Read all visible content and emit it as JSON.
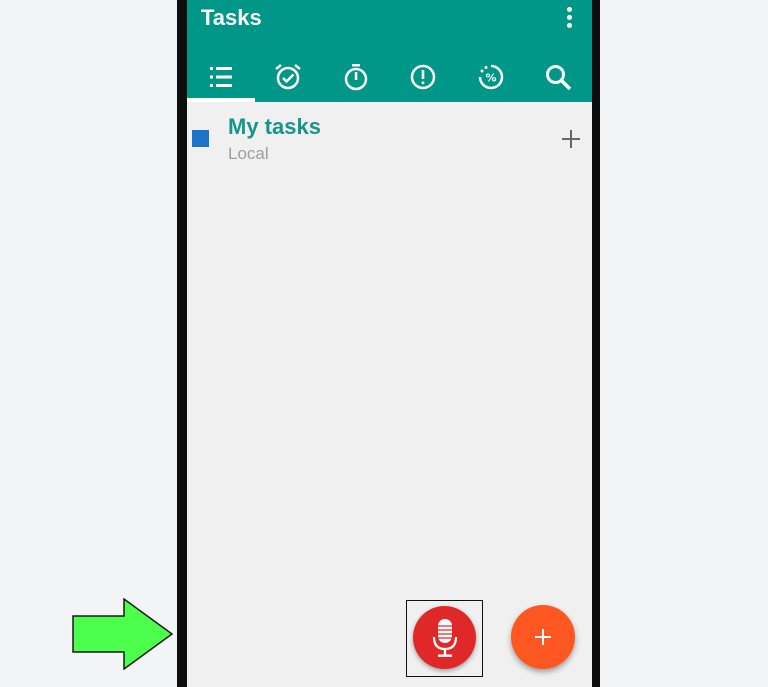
{
  "appbar": {
    "title": "Tasks",
    "background_color": "#009688",
    "overflow_icon": "more-vert-icon"
  },
  "tabs": [
    {
      "name": "list",
      "icon": "list-icon",
      "active": true
    },
    {
      "name": "reminder",
      "icon": "alarm-check-icon",
      "active": false
    },
    {
      "name": "timer",
      "icon": "stopwatch-icon",
      "active": false
    },
    {
      "name": "priority",
      "icon": "priority-icon",
      "active": false
    },
    {
      "name": "progress",
      "icon": "progress-percent-icon",
      "active": false
    },
    {
      "name": "search",
      "icon": "search-icon",
      "active": false
    }
  ],
  "task_list": {
    "title": "My tasks",
    "subtitle": "Local",
    "color": "#1e73c8",
    "add_icon": "plus-icon"
  },
  "voice_button": {
    "icon": "microphone-icon",
    "color": "#e02828"
  },
  "fab": {
    "icon": "plus-icon",
    "color": "#ff5722"
  },
  "pointer_arrow": {
    "icon": "right-arrow-icon",
    "color": "#4cff4c"
  }
}
